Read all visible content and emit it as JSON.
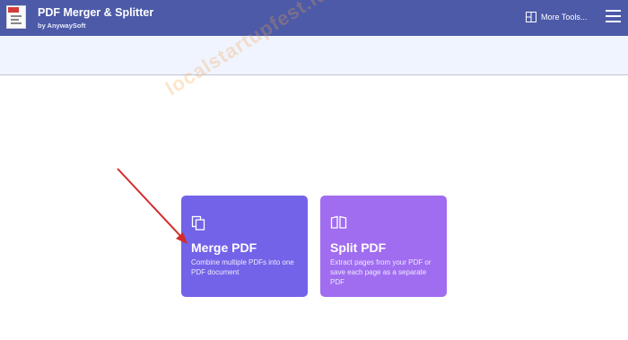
{
  "header": {
    "title": "PDF Merger & Splitter",
    "subtitle": "by AnywaySoft",
    "more_tools_label": "More Tools...",
    "background_color": "#4c5aa8"
  },
  "watermark": {
    "text": "localstartupfest.id"
  },
  "cards": [
    {
      "title": "Merge PDF",
      "description": "Combine multiple PDFs into one PDF document",
      "icon": "copy-documents-icon",
      "color": "#7363e8"
    },
    {
      "title": "Split PDF",
      "description": "Extract pages from your PDF or save each page as a separate PDF",
      "icon": "split-pages-icon",
      "color": "#a06cf0"
    }
  ],
  "annotation": {
    "arrow_color": "#d42a2a"
  }
}
